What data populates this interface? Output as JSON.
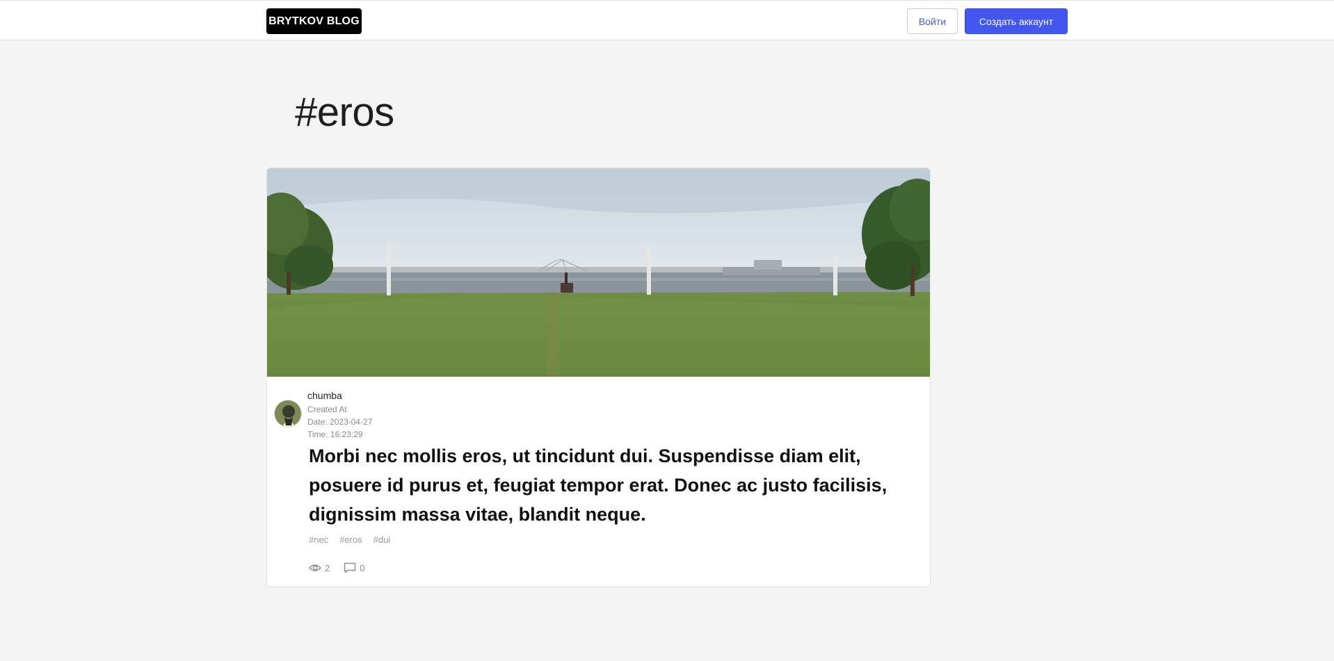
{
  "header": {
    "logo": "BRYTKOV BLOG",
    "login_label": "Войти",
    "signup_label": "Создать аккаунт"
  },
  "page": {
    "title": "#eros"
  },
  "post": {
    "author": "chumba",
    "created_label": "Created At",
    "date": "Date: 2023-04-27",
    "time": "Time: 16:23:29",
    "title": "Morbi nec mollis eros, ut tincidunt dui. Suspendisse diam elit, posuere id purus et, feugiat tempor erat. Donec ac justo facilisis, dignissim massa vitae, blandit neque.",
    "tags": [
      "#nec",
      "#eros",
      "#dui"
    ],
    "views": "2",
    "comments": "0"
  },
  "colors": {
    "accent": "#4357ee",
    "background": "#f4f4f4",
    "logo_bg": "#000000"
  },
  "icons": {
    "views": "eye-icon",
    "comments": "comment-icon"
  }
}
